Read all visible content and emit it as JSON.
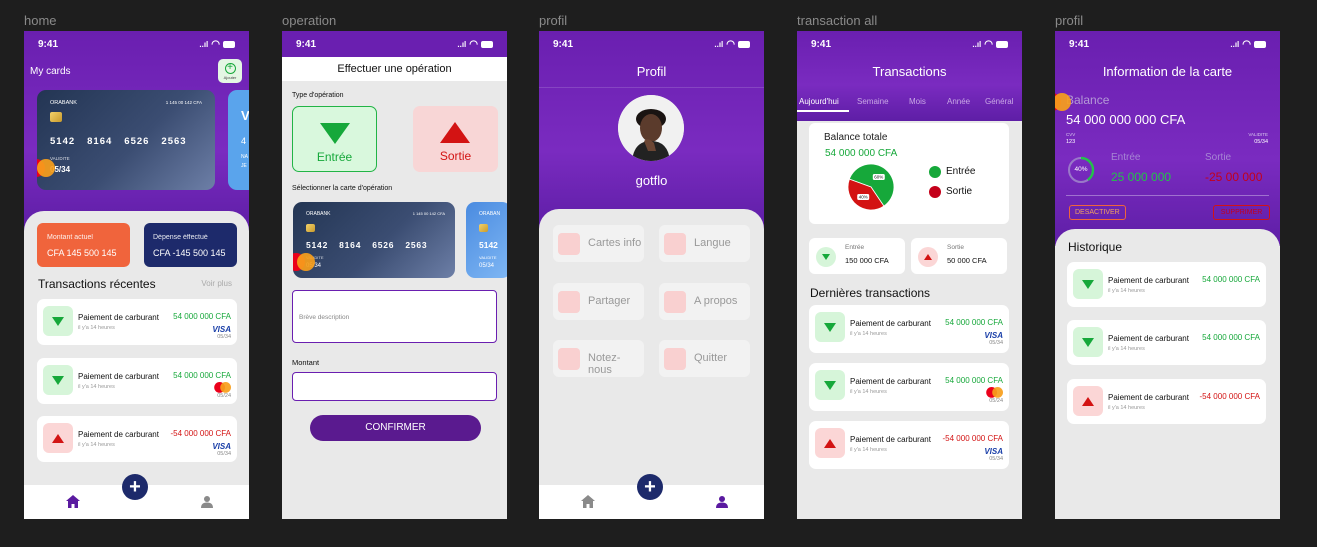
{
  "frames": {
    "home": "home",
    "operation": "operation",
    "profil": "profil",
    "transactions": "transaction all",
    "card_info": "profil"
  },
  "status": {
    "time": "9:41",
    "signal": "..ıl"
  },
  "icons": {
    "home": "home-icon",
    "user": "user-icon",
    "plus": "plus-icon",
    "add": "add-circle-icon"
  },
  "colors": {
    "primary": "#6a1fb0",
    "positive": "#16a83a",
    "negative": "#d31313",
    "navy": "#1d2a6b",
    "orange": "#f0643c"
  },
  "card_primary": {
    "bank": "ORABANK",
    "balance": "1 145 00 142 CFA",
    "number": [
      "5142",
      "8164",
      "6526",
      "2563"
    ],
    "validity_label": "VALIDITE",
    "expiry": "05/34"
  },
  "card_secondary": {
    "bank": "ORABAN",
    "number": "5142",
    "validity_label": "VALIDITE",
    "expiry": "05/34",
    "letter": "V",
    "digit": "4",
    "na": "NA",
    "je": "JE"
  },
  "home": {
    "title": "My cards",
    "add_label": "Ajouter",
    "current_label": "Montant actuel",
    "current_value": "CFA 145 500 145",
    "expense_label": "Dépense éffectué",
    "expense_value": "CFA -145 500 145",
    "recent_title": "Transactions récentes",
    "see_more": "Voir plus"
  },
  "transactions": [
    {
      "name": "Paiement de carburant",
      "time": "il y'a 14 heures",
      "amount": "54 000 000 CFA",
      "brand": "VISA",
      "expiry": "05/34"
    },
    {
      "name": "Paiement de carburant",
      "time": "il y'a 14 heures",
      "amount": "54 000 000 CFA",
      "brand": "mastercard",
      "expiry": "05/24"
    },
    {
      "name": "Paiement de carburant",
      "time": "il y'a 14 heures",
      "amount": "-54 000 000 CFA",
      "brand": "VISA",
      "expiry": "05/34"
    }
  ],
  "operation": {
    "title": "Effectuer une opération",
    "type_label": "Type d'opération",
    "entry": "Entrée",
    "exit": "Sortie",
    "select_card_label": "Sélectionner la carte  d'opération",
    "description_placeholder": "Brève description",
    "amount_label": "Montant",
    "confirm": "CONFIRMER"
  },
  "profile": {
    "title": "Profil",
    "username": "gotflo",
    "menu": [
      "Cartes info",
      "Langue",
      "Partager",
      "A propos",
      "Notez-nous",
      "Quitter"
    ]
  },
  "trans_all": {
    "title": "Transactions",
    "tabs": [
      "Aujourd'hui",
      "Semaine",
      "Mois",
      "Année",
      "Général"
    ],
    "balance_label": "Balance totale",
    "balance_value": "54 000 000 CFA",
    "pie_pct_out": "40%",
    "pie_pct_in": "60%",
    "legend_in": "Entrée",
    "legend_out": "Sortie",
    "in_label": "Entrée",
    "in_value": "150 000 CFA",
    "out_label": "Sortie",
    "out_value": "50 000 CFA",
    "last_title": "Dernières transactions"
  },
  "card_info": {
    "title": "Information de la carte",
    "balance_label": "Balance",
    "balance_value": "54 000 000 000 CFA",
    "cvv_label": "CVV",
    "cvv_value": "123",
    "validity_label": "VALIDITE",
    "validity_value": "05/34",
    "percent": "40%",
    "in_label": "Entrée",
    "in_value": "25 000 000",
    "out_label": "Sortie",
    "out_value": "-25 00 000",
    "deactivate": "DESACTIVER",
    "delete": "SUPPRIMER",
    "history_title": "Historique",
    "history": [
      {
        "name": "Paiement de carburant",
        "time": "il y'a 14 heures",
        "amount": "54 000 000 CFA"
      },
      {
        "name": "Paiement de carburant",
        "time": "il y'a 14 heures",
        "amount": "54 000 000 CFA"
      },
      {
        "name": "Paiement de carburant",
        "time": "il y'a 14 heures",
        "amount": "-54 000 000 CFA"
      }
    ]
  },
  "chart_data": {
    "type": "pie",
    "categories": [
      "Entrée",
      "Sortie"
    ],
    "values": [
      60,
      40
    ],
    "title": ""
  }
}
